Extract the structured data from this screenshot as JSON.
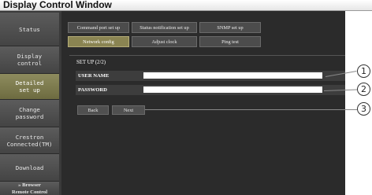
{
  "window": {
    "title": "Display Control Window"
  },
  "sidebar": {
    "items": [
      {
        "label": "Status"
      },
      {
        "label": "Display\ncontrol"
      },
      {
        "label": "Detailed\nset up"
      },
      {
        "label": "Change\npassword"
      },
      {
        "label": "Crestron\nConnected(TM)"
      },
      {
        "label": "Download"
      },
      {
        "label": "» Browser\nRemote Control"
      }
    ]
  },
  "tabs": [
    {
      "label": "Command port set up"
    },
    {
      "label": "Status notification set up"
    },
    {
      "label": "SNMP set up"
    },
    {
      "label": "Network config"
    },
    {
      "label": "Adjust clock"
    },
    {
      "label": "Ping test"
    }
  ],
  "form": {
    "setup_title": "SET UP (2/2)",
    "username_label": "USER NAME",
    "password_label": "PASSWORD",
    "back_label": "Back",
    "next_label": "Next"
  },
  "callouts": [
    "1",
    "2",
    "3"
  ]
}
